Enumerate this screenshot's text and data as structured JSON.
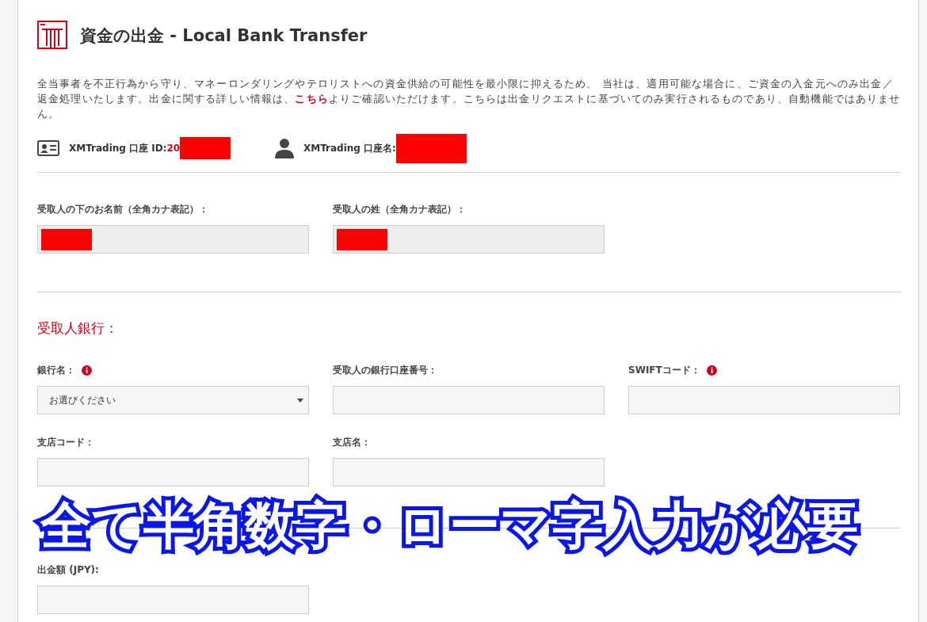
{
  "header": {
    "title": "資金の出金 - Local Bank Transfer"
  },
  "notice": {
    "before": "全当事者を不正行為から守り、マネーロンダリングやテロリストへの資金供給の可能性を最小限に抑えるため、 当社は、適用可能な場合に、ご資金の入金元へのみ出金／返金処理いたします。出金に関する詳しい情報は、",
    "link": "こちら",
    "after": "よりご確認いただけます。こちらは出金リクエストに基づいてのみ実行されるものであり、自動機能ではありません。"
  },
  "account": [
    {
      "kind": "id",
      "label": "XMTrading 口座 ID:",
      "value": "20",
      "redacted": true
    },
    {
      "kind": "name",
      "label": "XMTrading 口座名:",
      "redacted": true
    }
  ],
  "recipient_fields": [
    {
      "label": "受取人の下のお名前（全角カナ表記）：",
      "redacted": true
    },
    {
      "label": "受取人の姓（全角カナ表記）：",
      "redacted": true
    }
  ],
  "bank_section": {
    "title": "受取人銀行：",
    "fields": [
      {
        "kind": "select",
        "label": "銀行名：",
        "info": true,
        "value": "お選びください"
      },
      {
        "kind": "text",
        "label": "受取人の銀行口座番号：",
        "info": false
      },
      {
        "kind": "text",
        "label": "SWIFTコード：",
        "info": true
      },
      {
        "kind": "text",
        "label": "支店コード：",
        "info": false
      },
      {
        "kind": "text",
        "label": "支店名：",
        "info": false
      }
    ]
  },
  "amount_field": {
    "label": "出金額 (JPY):"
  },
  "callout": "全て半角数字・ローマ字入力が必要"
}
